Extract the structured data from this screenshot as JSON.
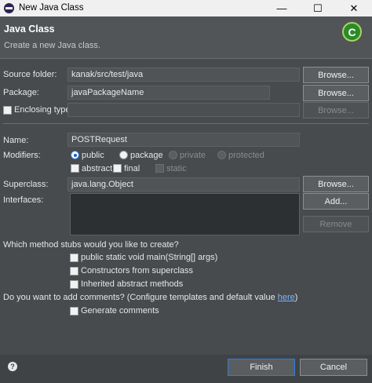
{
  "window": {
    "title": "New Java Class",
    "minimize": "—",
    "maximize": "☐",
    "close": "✕"
  },
  "header": {
    "title": "Java Class",
    "subtitle": "Create a new Java class.",
    "logo_letter": "C"
  },
  "source_folder": {
    "label": "Source folder:",
    "value": "kanak/src/test/java",
    "browse": "Browse..."
  },
  "package": {
    "label": "Package:",
    "value": "javaPackageName",
    "browse": "Browse..."
  },
  "enclosing": {
    "label": "Enclosing type:",
    "value": "",
    "browse": "Browse..."
  },
  "name": {
    "label": "Name:",
    "value": "POSTRequest"
  },
  "modifiers": {
    "label": "Modifiers:",
    "radios": [
      "public",
      "package",
      "private",
      "protected"
    ],
    "selected": "public",
    "checks": [
      "abstract",
      "final",
      "static"
    ]
  },
  "superclass": {
    "label": "Superclass:",
    "value": "java.lang.Object",
    "browse": "Browse..."
  },
  "interfaces": {
    "label": "Interfaces:",
    "add": "Add...",
    "remove": "Remove"
  },
  "stubs": {
    "question": "Which method stubs would you like to create?",
    "options": [
      "public static void main(String[] args)",
      "Constructors from superclass",
      "Inherited abstract methods"
    ]
  },
  "comments": {
    "question": "Do you want to add comments? (Configure templates and default value ",
    "link": "here",
    "question_end": ")",
    "option": "Generate comments"
  },
  "footer": {
    "help": "?",
    "finish": "Finish",
    "cancel": "Cancel"
  },
  "colors": {
    "background": "#474b4e",
    "header": "#515558",
    "accent": "#2f7ddc"
  }
}
